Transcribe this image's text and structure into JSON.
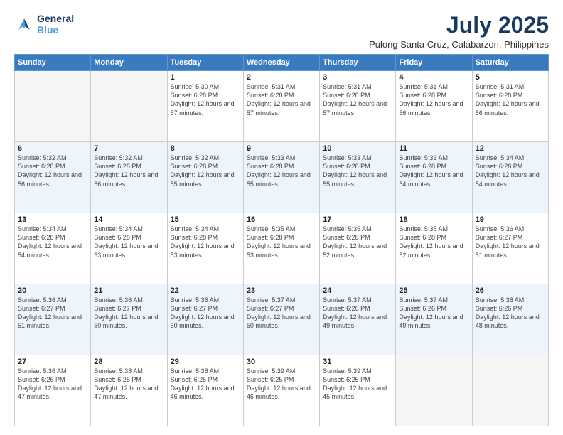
{
  "logo": {
    "line1": "General",
    "line2": "Blue"
  },
  "title": "July 2025",
  "subtitle": "Pulong Santa Cruz, Calabarzon, Philippines",
  "weekdays": [
    "Sunday",
    "Monday",
    "Tuesday",
    "Wednesday",
    "Thursday",
    "Friday",
    "Saturday"
  ],
  "weeks": [
    [
      {
        "day": "",
        "info": ""
      },
      {
        "day": "",
        "info": ""
      },
      {
        "day": "1",
        "info": "Sunrise: 5:30 AM\nSunset: 6:28 PM\nDaylight: 12 hours and 57 minutes."
      },
      {
        "day": "2",
        "info": "Sunrise: 5:31 AM\nSunset: 6:28 PM\nDaylight: 12 hours and 57 minutes."
      },
      {
        "day": "3",
        "info": "Sunrise: 5:31 AM\nSunset: 6:28 PM\nDaylight: 12 hours and 57 minutes."
      },
      {
        "day": "4",
        "info": "Sunrise: 5:31 AM\nSunset: 6:28 PM\nDaylight: 12 hours and 56 minutes."
      },
      {
        "day": "5",
        "info": "Sunrise: 5:31 AM\nSunset: 6:28 PM\nDaylight: 12 hours and 56 minutes."
      }
    ],
    [
      {
        "day": "6",
        "info": "Sunrise: 5:32 AM\nSunset: 6:28 PM\nDaylight: 12 hours and 56 minutes."
      },
      {
        "day": "7",
        "info": "Sunrise: 5:32 AM\nSunset: 6:28 PM\nDaylight: 12 hours and 56 minutes."
      },
      {
        "day": "8",
        "info": "Sunrise: 5:32 AM\nSunset: 6:28 PM\nDaylight: 12 hours and 55 minutes."
      },
      {
        "day": "9",
        "info": "Sunrise: 5:33 AM\nSunset: 6:28 PM\nDaylight: 12 hours and 55 minutes."
      },
      {
        "day": "10",
        "info": "Sunrise: 5:33 AM\nSunset: 6:28 PM\nDaylight: 12 hours and 55 minutes."
      },
      {
        "day": "11",
        "info": "Sunrise: 5:33 AM\nSunset: 6:28 PM\nDaylight: 12 hours and 54 minutes."
      },
      {
        "day": "12",
        "info": "Sunrise: 5:34 AM\nSunset: 6:28 PM\nDaylight: 12 hours and 54 minutes."
      }
    ],
    [
      {
        "day": "13",
        "info": "Sunrise: 5:34 AM\nSunset: 6:28 PM\nDaylight: 12 hours and 54 minutes."
      },
      {
        "day": "14",
        "info": "Sunrise: 5:34 AM\nSunset: 6:28 PM\nDaylight: 12 hours and 53 minutes."
      },
      {
        "day": "15",
        "info": "Sunrise: 5:34 AM\nSunset: 6:28 PM\nDaylight: 12 hours and 53 minutes."
      },
      {
        "day": "16",
        "info": "Sunrise: 5:35 AM\nSunset: 6:28 PM\nDaylight: 12 hours and 53 minutes."
      },
      {
        "day": "17",
        "info": "Sunrise: 5:35 AM\nSunset: 6:28 PM\nDaylight: 12 hours and 52 minutes."
      },
      {
        "day": "18",
        "info": "Sunrise: 5:35 AM\nSunset: 6:28 PM\nDaylight: 12 hours and 52 minutes."
      },
      {
        "day": "19",
        "info": "Sunrise: 5:36 AM\nSunset: 6:27 PM\nDaylight: 12 hours and 51 minutes."
      }
    ],
    [
      {
        "day": "20",
        "info": "Sunrise: 5:36 AM\nSunset: 6:27 PM\nDaylight: 12 hours and 51 minutes."
      },
      {
        "day": "21",
        "info": "Sunrise: 5:36 AM\nSunset: 6:27 PM\nDaylight: 12 hours and 50 minutes."
      },
      {
        "day": "22",
        "info": "Sunrise: 5:36 AM\nSunset: 6:27 PM\nDaylight: 12 hours and 50 minutes."
      },
      {
        "day": "23",
        "info": "Sunrise: 5:37 AM\nSunset: 6:27 PM\nDaylight: 12 hours and 50 minutes."
      },
      {
        "day": "24",
        "info": "Sunrise: 5:37 AM\nSunset: 6:26 PM\nDaylight: 12 hours and 49 minutes."
      },
      {
        "day": "25",
        "info": "Sunrise: 5:37 AM\nSunset: 6:26 PM\nDaylight: 12 hours and 49 minutes."
      },
      {
        "day": "26",
        "info": "Sunrise: 5:38 AM\nSunset: 6:26 PM\nDaylight: 12 hours and 48 minutes."
      }
    ],
    [
      {
        "day": "27",
        "info": "Sunrise: 5:38 AM\nSunset: 6:26 PM\nDaylight: 12 hours and 47 minutes."
      },
      {
        "day": "28",
        "info": "Sunrise: 5:38 AM\nSunset: 6:25 PM\nDaylight: 12 hours and 47 minutes."
      },
      {
        "day": "29",
        "info": "Sunrise: 5:38 AM\nSunset: 6:25 PM\nDaylight: 12 hours and 46 minutes."
      },
      {
        "day": "30",
        "info": "Sunrise: 5:39 AM\nSunset: 6:25 PM\nDaylight: 12 hours and 46 minutes."
      },
      {
        "day": "31",
        "info": "Sunrise: 5:39 AM\nSunset: 6:25 PM\nDaylight: 12 hours and 45 minutes."
      },
      {
        "day": "",
        "info": ""
      },
      {
        "day": "",
        "info": ""
      }
    ]
  ]
}
